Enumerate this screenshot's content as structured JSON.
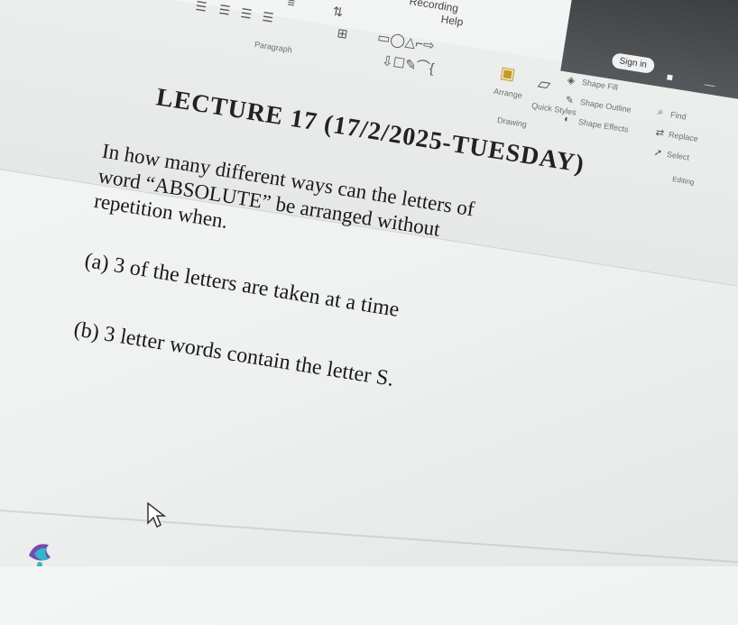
{
  "ribbon": {
    "recording_tab": "Recording",
    "help_tab": "Help",
    "paragraph_group": "Paragraph",
    "drawing_group": "Drawing",
    "editing_group": "Editing",
    "arrange_label": "Arrange",
    "quick_styles_label": "Quick Styles",
    "shape_fill": "Shape Fill",
    "shape_outline": "Shape Outline",
    "shape_effects": "Shape Effects",
    "find_label": "Find",
    "replace_label": "Replace",
    "select_label": "Select",
    "sign_in": "Sign in"
  },
  "slide": {
    "title": "LECTURE 17 (17/2/2025-TUESDAY)",
    "question_line1": "In how many different ways can the letters of",
    "question_line2": "word “ABSOLUTE” be arranged without",
    "question_line3": "repetition when.",
    "part_a": "(a)   3 of the letters are taken at a time",
    "part_b": "(b)   3 letter words contain the letter S."
  },
  "colors": {
    "ribbon_bg": "#e8eaea",
    "slide_text": "#1a1a1a",
    "accent_purple": "#7a4ab0",
    "accent_teal": "#2fb8c9"
  }
}
